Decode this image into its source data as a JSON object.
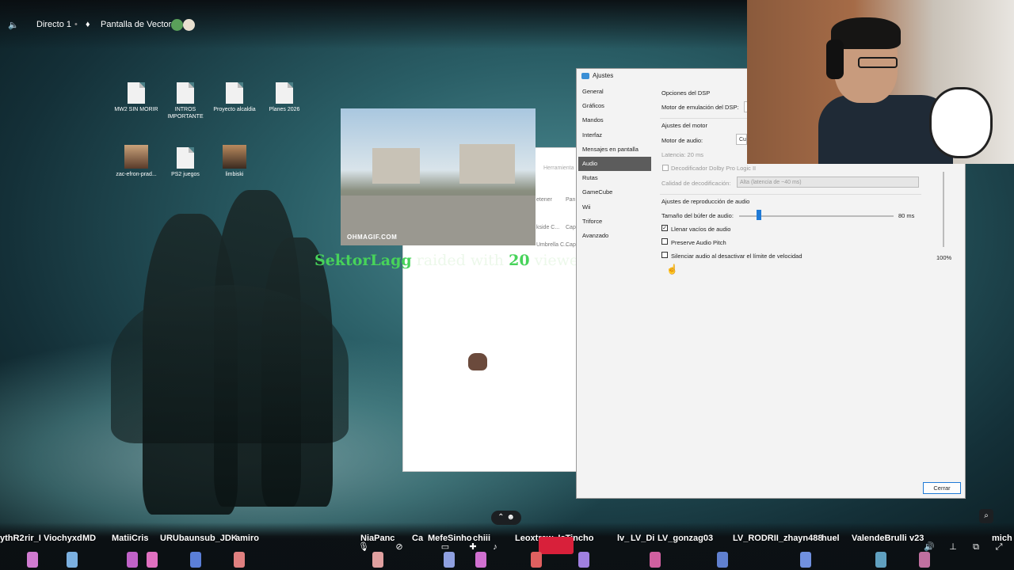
{
  "topbar": {
    "channel": "Directo 1",
    "screen": "Pantalla de Vector"
  },
  "desktop_icons": [
    {
      "label": "MW2 SIN MORIR",
      "kind": "file"
    },
    {
      "label": "INTROS IMPORTANTE",
      "kind": "file"
    },
    {
      "label": "Proyecto alcaldia",
      "kind": "file"
    },
    {
      "label": "Planes 2026",
      "kind": "file"
    },
    {
      "label": "zac-efron-prad...",
      "kind": "picture"
    },
    {
      "label": "PS2 juegos",
      "kind": "file"
    },
    {
      "label": "limbiski",
      "kind": "picture"
    }
  ],
  "gif": {
    "brand": "OHMAGIF.COM"
  },
  "raid": {
    "user": "SektorLagg",
    "mid": "raided with",
    "count": "20",
    "end": "viewers!"
  },
  "background_window": {
    "title": "Herramienta",
    "lines": [
      "etener",
      "Pan",
      "kside C...",
      "Cap",
      "Umbrella C...",
      "Cap"
    ]
  },
  "settings": {
    "title": "Ajustes",
    "nav": [
      "General",
      "Gráficos",
      "Mandos",
      "Interfaz",
      "Mensajes en pantalla",
      "Audio",
      "Rutas",
      "GameCube",
      "Wii",
      "Triforce",
      "Avanzado"
    ],
    "selected": "Audio",
    "dsp_header": "Opciones del DSP",
    "dsp_engine_label": "Motor de emulación del DSP:",
    "engine_header": "Ajustes del motor",
    "audio_engine_label": "Motor de audio:",
    "audio_engine_value": "Cu",
    "latency_label": "Latencia: 20 ms",
    "dolby_label": "Decodificador Dolby Pro Logic II",
    "decode_quality_label": "Calidad de decodificación:",
    "decode_quality_value": "Alta (latencia de ~40 ms)",
    "playback_header": "Ajustes de reproducción de audio",
    "buffer_label": "Tamaño del búfer de audio:",
    "buffer_value": "80 ms",
    "buffer_fraction": 0.13,
    "fill_gaps_label": "Llenar vacíos de audio",
    "fill_gaps_checked": true,
    "pitch_label": "Preserve Audio Pitch",
    "pitch_checked": false,
    "mute_label": "Silenciar audio al desactivar el límite de velocidad",
    "mute_checked": false,
    "volume_value": "100%",
    "close_button": "Cerrar"
  },
  "chat_names": [
    "ythR2",
    "rir_I",
    "Viochyxd",
    "MD",
    "MatiiCris",
    "URUbaunsub_JDK",
    "amiro",
    "NiaPanc",
    "Ca",
    "MefeSinho",
    "chiii",
    "Leoxtrew_IsTincho",
    "lv_",
    "LV_Di",
    "LV_gonzag03",
    "LV_RODRII_zhayn488",
    "huel",
    "ValendeBrulli",
    "v23",
    "mich"
  ],
  "colors": {
    "raid_green": "#47d35a",
    "accent_blue": "#1f7ad6",
    "record_red": "#d8203a"
  }
}
